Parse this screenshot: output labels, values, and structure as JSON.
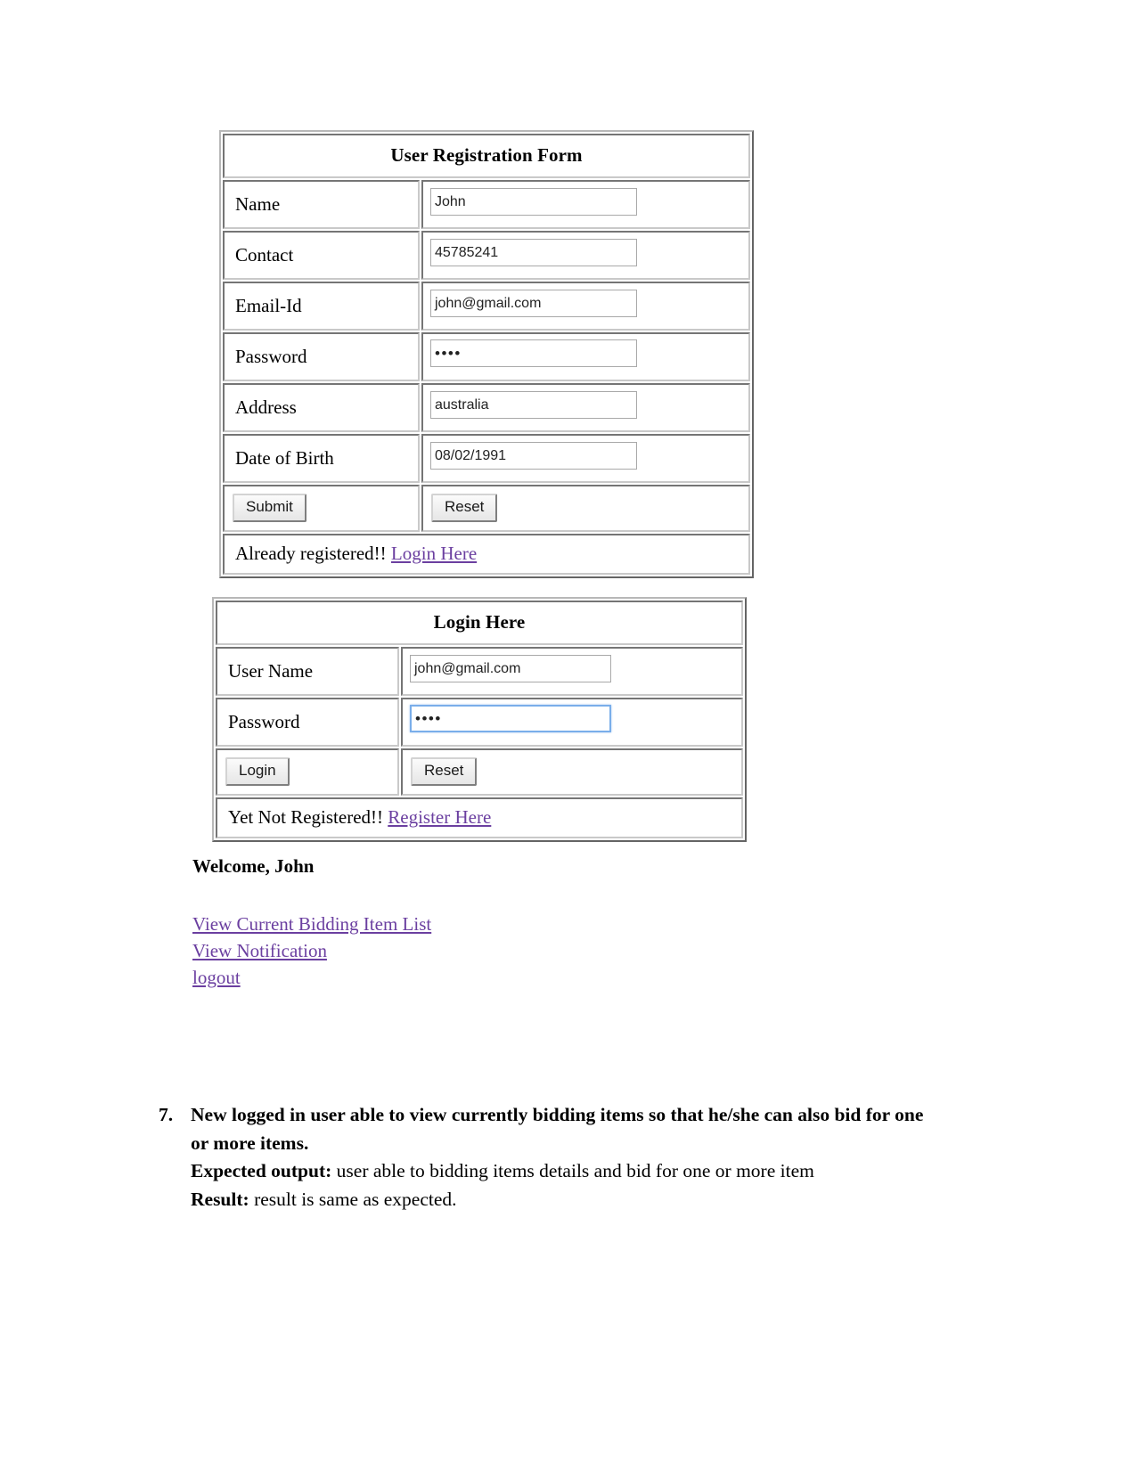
{
  "registration_form": {
    "title": "User Registration Form",
    "fields": [
      {
        "label": "Name",
        "value": "John"
      },
      {
        "label": "Contact",
        "value": "45785241"
      },
      {
        "label": "Email-Id",
        "value": "john@gmail.com"
      },
      {
        "label": "Password",
        "value": "••••"
      },
      {
        "label": "Address",
        "value": "australia"
      },
      {
        "label": "Date of Birth",
        "value": "08/02/1991"
      }
    ],
    "submit_label": "Submit",
    "reset_label": "Reset",
    "footer_text": "Already registered!!",
    "footer_link": "Login Here"
  },
  "login_form": {
    "title": "Login Here",
    "username_label": "User Name",
    "username_value": "john@gmail.com",
    "password_label": "Password",
    "password_value": "••••",
    "login_label": "Login",
    "reset_label": "Reset",
    "footer_text": "Yet Not Registered!!",
    "footer_link": "Register Here"
  },
  "dashboard": {
    "welcome": "Welcome, John",
    "links": [
      "View Current Bidding Item List",
      "View Notification",
      "logout"
    ]
  },
  "test_case": {
    "number": "7.",
    "description": "New logged in user able to view currently bidding items so that he/she can also bid for one or more items.",
    "expected_label": "Expected output:",
    "expected_text": "user able to bidding items details and bid for one or more item",
    "result_label": "Result:",
    "result_text": "result is same as expected."
  },
  "colors": {
    "link": "#6b3fa0",
    "focus_border": "#7aaeea",
    "page_background": "#ffffff"
  }
}
